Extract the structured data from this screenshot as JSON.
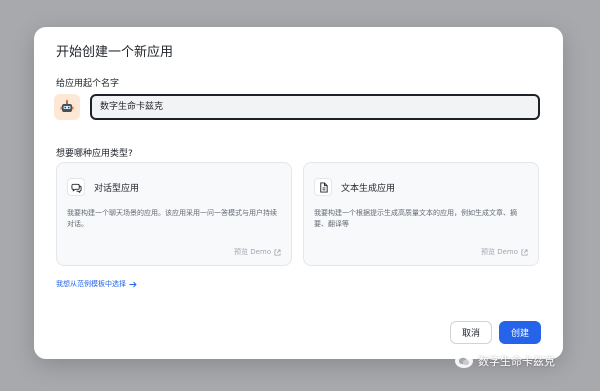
{
  "dialog": {
    "title": "开始创建一个新应用",
    "name_label": "给应用起个名字",
    "name_value": "数字生命卡兹克",
    "type_label": "想要哪种应用类型?"
  },
  "cards": [
    {
      "icon": "chat-bubble-icon",
      "title": "对话型应用",
      "desc": "我要构建一个聊天场景的应用。该应用采用一问一答模式与用户持续对话。",
      "demo": "预览 Demo"
    },
    {
      "icon": "document-icon",
      "title": "文本生成应用",
      "desc": "我要构建一个根据提示生成高质量文本的应用，例如生成文章、摘要、翻译等",
      "demo": "预览 Demo"
    }
  ],
  "template_link": "我想从范例模板中选择",
  "buttons": {
    "cancel": "取消",
    "create": "创建"
  },
  "watermark": "数字生命卡兹克",
  "colors": {
    "accent": "#2563eb",
    "overlay": "#a7a9ad",
    "avatar_bg": "#fde8d6"
  }
}
